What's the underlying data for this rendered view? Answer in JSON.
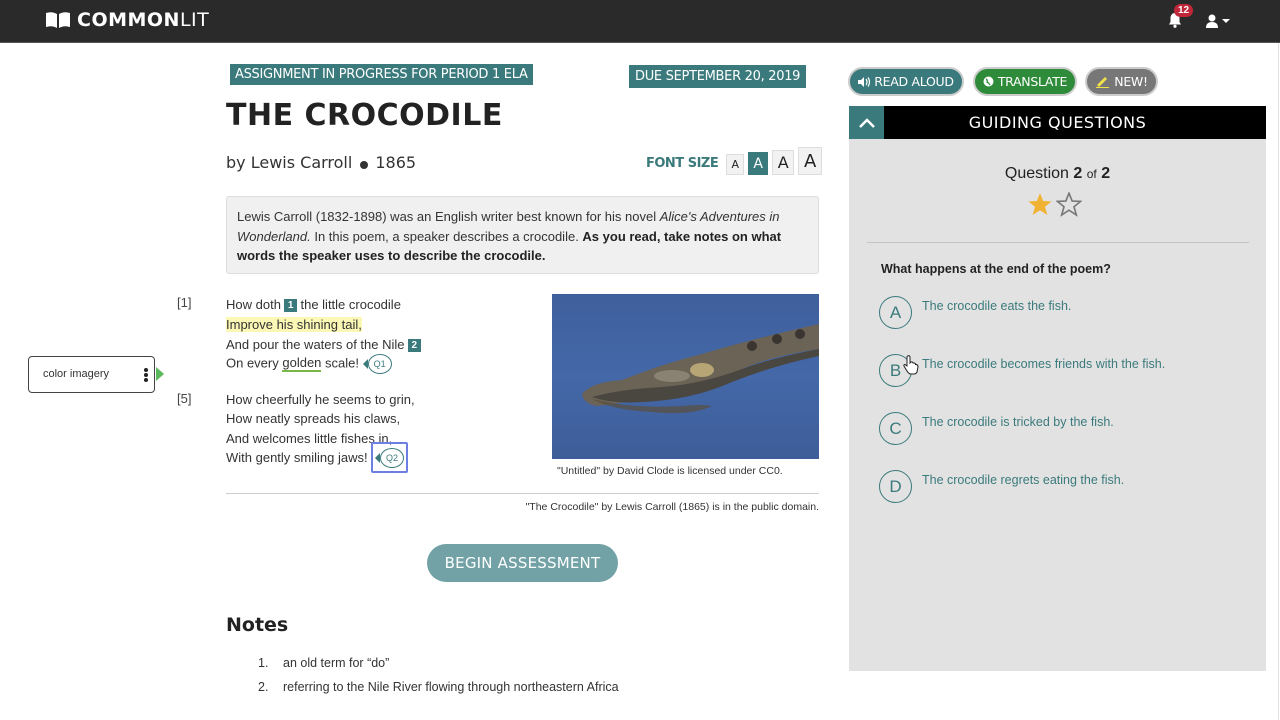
{
  "app": {
    "logo_bold": "COMMON",
    "logo_light": "LIT",
    "notifications_count": "12"
  },
  "assignment": {
    "status_badge": "ASSIGNMENT IN PROGRESS FOR PERIOD 1 ELA",
    "due_badge": "DUE SEPTEMBER 20, 2019",
    "title": "THE CROCODILE",
    "author": "by Lewis Carroll",
    "year": "1865",
    "font_size_label": "FONT SIZE",
    "font_size_options": [
      "A",
      "A",
      "A",
      "A"
    ],
    "font_size_selected_index": 1
  },
  "intro": {
    "part1": "Lewis Carroll (1832-1898) was an English writer best known for his novel ",
    "italic": "Alice's Adventures in Wonderland.",
    "part2": " In this poem, a speaker describes a crocodile. ",
    "bold": "As you read, take notes on what words the speaker uses to describe the crocodile."
  },
  "poem": {
    "line_numbers": [
      "[1]",
      "[5]"
    ],
    "stanza1": {
      "l1_a": "How doth",
      "l1_note": "1",
      "l1_b": "the little crocodile",
      "l2": "Improve his shining tail,",
      "l3_a": "And pour the waters of the Nile",
      "l3_note": "2",
      "l4_a": "On every ",
      "l4_golden": "golden",
      "l4_b": " scale!",
      "l4_q": "Q1"
    },
    "stanza2": {
      "l5": "How cheerfully he seems to grin,",
      "l6": "How neatly spreads his claws,",
      "l7": "And welcomes little fishes in,",
      "l8": "With gently smiling jaws!",
      "l8_q": "Q2"
    }
  },
  "annotation": {
    "label": "color imagery",
    "color": "#5cb85c"
  },
  "image": {
    "caption": "\"Untitled\" by David Clode is licensed under CC0."
  },
  "credit": "\"The Crocodile\" by Lewis Carroll (1865) is in the public domain.",
  "begin_button": "BEGIN ASSESSMENT",
  "notes": {
    "heading": "Notes",
    "items": [
      {
        "num": "1.",
        "text": "an old term for “do”"
      },
      {
        "num": "2.",
        "text": "referring to the Nile River flowing through northeastern Africa"
      }
    ]
  },
  "tools": {
    "read_aloud": "READ ALOUD",
    "translate": "TRANSLATE",
    "new": "NEW!"
  },
  "guiding_questions": {
    "title": "GUIDING QUESTIONS",
    "question_label": "Question",
    "current": "2",
    "of_label": "of",
    "total": "2",
    "stars_filled": 1,
    "stars_total": 2,
    "question": "What happens at the end of the poem?",
    "options": [
      {
        "letter": "A",
        "text": "The crocodile eats the fish."
      },
      {
        "letter": "B",
        "text": "The crocodile becomes friends with the fish."
      },
      {
        "letter": "C",
        "text": "The crocodile is tricked by the fish."
      },
      {
        "letter": "D",
        "text": "The crocodile regrets eating the fish."
      }
    ]
  },
  "colors": {
    "teal": "#3b7a7c",
    "green": "#2e8b3a",
    "star": "#f0b232",
    "nav": "#2a2a2a"
  }
}
